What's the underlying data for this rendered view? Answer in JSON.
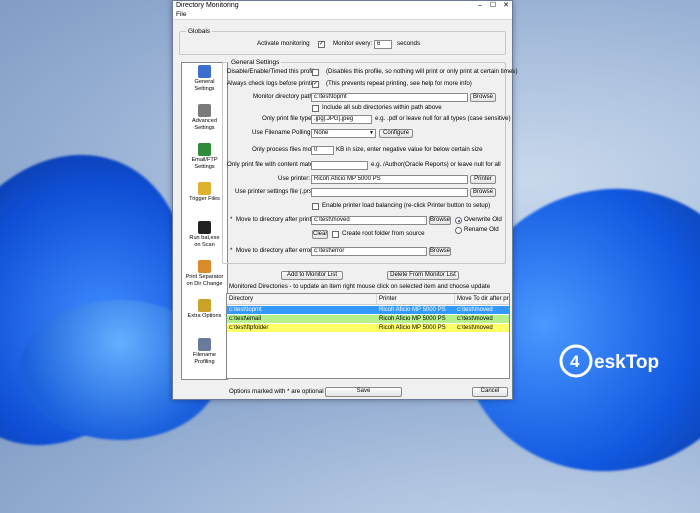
{
  "window": {
    "title": "Directory Monitoring",
    "menu_file": "File",
    "min_glyph": "–",
    "max_glyph": "☐",
    "close_glyph": "✕"
  },
  "globals": {
    "legend": "Globals",
    "activate_label": "Activate monitoring",
    "activate_checked": true,
    "monitor_every_label": "Monitor every:",
    "monitor_every_value": "6",
    "seconds_label": "seconds"
  },
  "general": {
    "legend": "General Settings",
    "disable_label": "Disable/Enable/Timed this profile",
    "disable_note": "(Disables this profile, so nothing will print or only print at certain times)",
    "disable_checked": false,
    "check_logs_label": "Always check logs before printing",
    "check_logs_note": "(This prevents repeat printing, see help for more info)",
    "check_logs_checked": true,
    "monitor_path_label": "Monitor directory path:",
    "monitor_path_value": "c:\\test\\topmt",
    "browse_label": "Browse",
    "include_sub_label": "Include all sub directories within path above",
    "include_sub_checked": false,
    "file_type_label": "Only print file type:",
    "file_type_value": ".jpg|.JPG|.jpeg",
    "file_type_note": "e.g. .pdf or leave null for all types (case sensitive)",
    "polling_label": "Use Filename Polling:",
    "polling_value": "None",
    "configure_label": "Configure",
    "size_label": "Only process files more than:",
    "size_value": "0",
    "size_note": "KB in size, enter negative value for below certain size",
    "content_label": "Only print file with content match:",
    "content_value": "",
    "content_note": "e.g. /Author(Oracle Reports) or leave null for all",
    "printer_label": "Use printer:",
    "printer_value": "Ricoh Aficio MP 5000 PS",
    "printer_button": "Printer",
    "settings_file_label": "Use printer settings file (.prs):",
    "settings_file_value": "",
    "load_balance_label": "Enable printer load balancing (re-click Printer button to setup)",
    "load_balance_checked": false,
    "move_after_label": "Move to directory after print:",
    "move_after_value": "c:\\test\\moved",
    "overwrite_label": "Overwrite Old",
    "overwrite_selected": true,
    "rename_label": "Rename Old",
    "rename_selected": false,
    "clear_label": "Clear",
    "create_root_label": "Create root folder from source",
    "create_root_checked": false,
    "move_error_label": "Move to directory after error:",
    "move_error_value": "c:\\test\\error"
  },
  "buttons": {
    "add": "Add to Monitor List",
    "delete": "Delete From Monitor List",
    "save": "Save",
    "cancel": "Cancel"
  },
  "monitored": {
    "caption": "Monitored Directories   -  to update an item right mouse click on selected item and choose update",
    "columns": [
      "Directory",
      "Printer",
      "Move To dir after pr"
    ],
    "rows": [
      {
        "directory": "c:\\test\\topmt",
        "printer": "Ricoh Aficio MP 5000 PS",
        "move": "c:\\test\\moved",
        "color": "#3399ff",
        "text_color": "#ffffff"
      },
      {
        "directory": "c:\\test\\email",
        "printer": "Ricoh Aficio MP 5000 PS",
        "move": "c:\\test\\moved",
        "color": "#b6f08a",
        "text_color": "#000000"
      },
      {
        "directory": "c:\\test\\ftpfolder",
        "printer": "Ricoh Aficio MP 5000 PS",
        "move": "c:\\test\\moved",
        "color": "#ffff66",
        "text_color": "#000000"
      }
    ]
  },
  "footer_note": "Options marked with * are optional",
  "nav": [
    {
      "label": "General\nSettings",
      "icon": "general-settings-icon",
      "color": "#3a6fd0"
    },
    {
      "label": "Advanced\nSettings",
      "icon": "advanced-settings-icon",
      "color": "#7a7a7a"
    },
    {
      "label": "Email/FTP\nSettings",
      "icon": "email-ftp-icon",
      "color": "#2f8a3a"
    },
    {
      "label": "Trigger Files",
      "icon": "trigger-files-icon",
      "color": "#e0b030"
    },
    {
      "label": "Run bat,exe\non Scan",
      "icon": "run-bat-exe-icon",
      "color": "#222222"
    },
    {
      "label": "Print Separator\non Dir Change",
      "icon": "print-separator-icon",
      "color": "#d98c2a"
    },
    {
      "label": "Extra Options",
      "icon": "extra-options-icon",
      "color": "#c9a227"
    },
    {
      "label": "Filename\nProfiling",
      "icon": "filename-profiling-icon",
      "color": "#6a7a9a"
    }
  ],
  "logo": {
    "brand_main": "4",
    "brand_text": "eskTop",
    "brand_color": "#ffffff"
  }
}
